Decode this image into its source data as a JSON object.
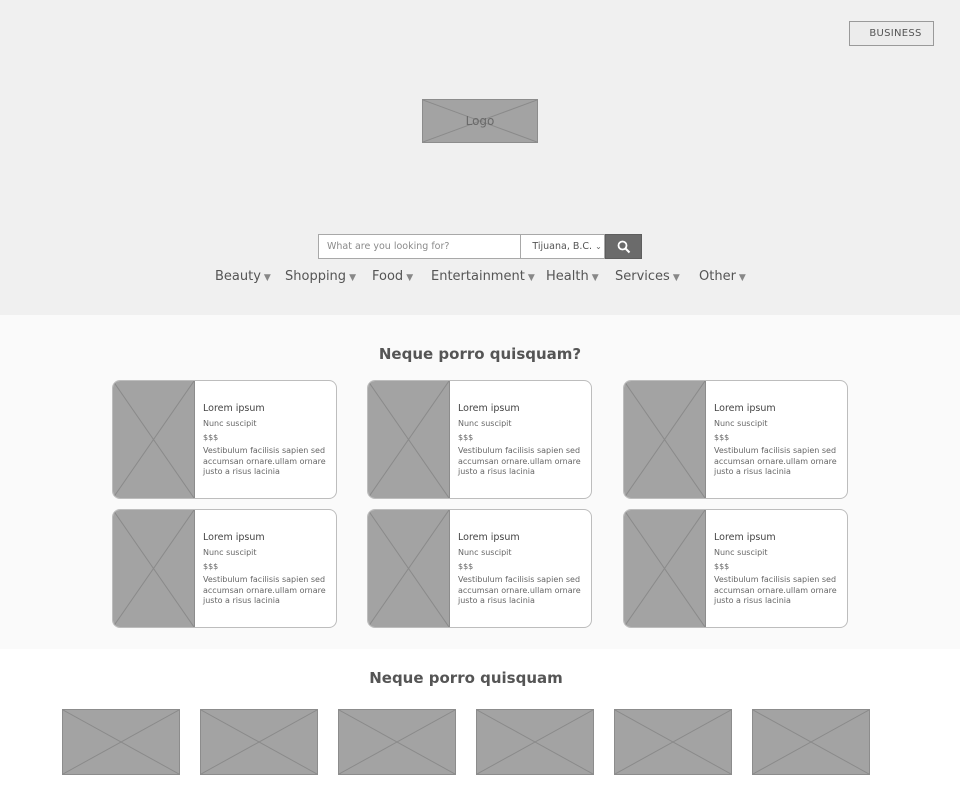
{
  "header": {
    "business_label": "BUSINESS",
    "logo_label": "Logo"
  },
  "search": {
    "placeholder": "What are you looking for?",
    "location": "Tijuana, B.C.",
    "button_icon": "search-icon"
  },
  "categories": [
    {
      "label": "Beauty"
    },
    {
      "label": "Shopping"
    },
    {
      "label": "Food"
    },
    {
      "label": "Entertainment"
    },
    {
      "label": "Health"
    },
    {
      "label": "Services"
    },
    {
      "label": "Other"
    }
  ],
  "featured": {
    "title": "Neque porro quisquam?",
    "cards": [
      {
        "title": "Lorem ipsum",
        "subtitle": "Nunc suscipit",
        "price": "$$$",
        "description": "Vestibulum facilisis sapien sed accumsan ornare.ullam ornare justo a risus lacinia"
      },
      {
        "title": "Lorem ipsum",
        "subtitle": "Nunc suscipit",
        "price": "$$$",
        "description": "Vestibulum facilisis sapien sed accumsan ornare.ullam ornare justo a risus lacinia"
      },
      {
        "title": "Lorem ipsum",
        "subtitle": "Nunc suscipit",
        "price": "$$$",
        "description": "Vestibulum facilisis sapien sed accumsan ornare.ullam ornare justo a risus lacinia"
      },
      {
        "title": "Lorem ipsum",
        "subtitle": "Nunc suscipit",
        "price": "$$$",
        "description": "Vestibulum facilisis sapien sed accumsan ornare.ullam ornare justo a risus lacinia"
      },
      {
        "title": "Lorem ipsum",
        "subtitle": "Nunc suscipit",
        "price": "$$$",
        "description": "Vestibulum facilisis sapien sed accumsan ornare.ullam ornare justo a risus lacinia"
      },
      {
        "title": "Lorem ipsum",
        "subtitle": "Nunc suscipit",
        "price": "$$$",
        "description": "Vestibulum facilisis sapien sed accumsan ornare.ullam ornare justo a risus lacinia"
      }
    ]
  },
  "strip": {
    "title": "Neque porro quisquam"
  },
  "colors": {
    "hero_bg": "#f0f0f0",
    "placeholder_gray": "#a3a3a3",
    "search_button": "#6b6b6b"
  }
}
